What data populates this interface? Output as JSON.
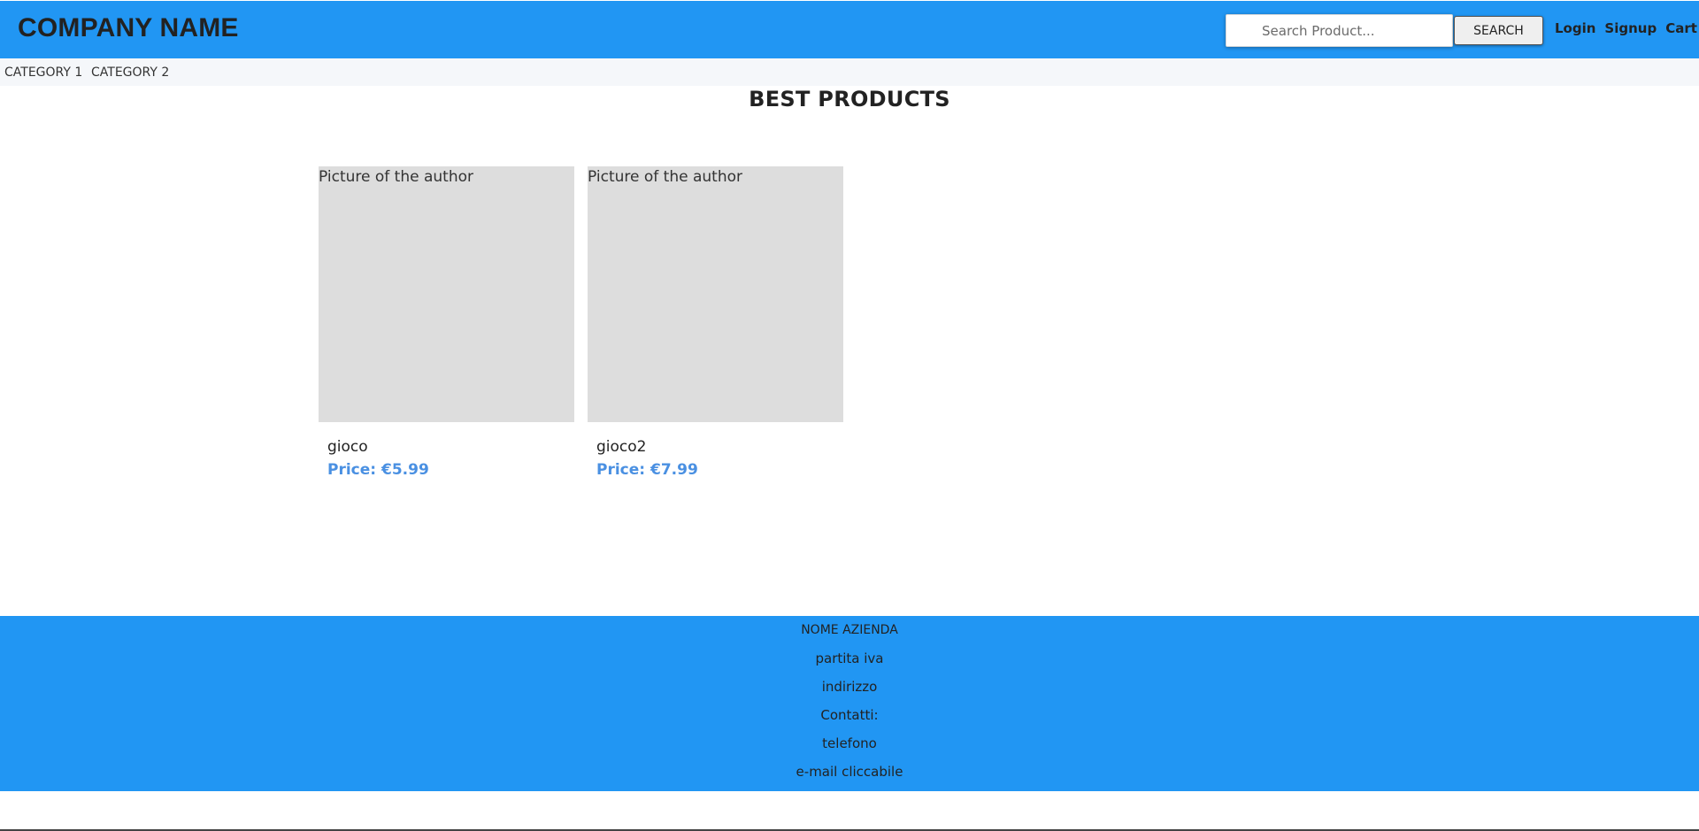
{
  "header": {
    "brand": "COMPANY NAME",
    "search_placeholder": "Search Product...",
    "search_button": "SEARCH",
    "links": {
      "login": "Login",
      "signup": "Signup",
      "cart": "Cart"
    },
    "bg_color": "#2196f3"
  },
  "categories": {
    "items": [
      "CATEGORY 1",
      "CATEGORY 2"
    ]
  },
  "main": {
    "title": "BEST PRODUCTS",
    "products": [
      {
        "image_alt": "Picture of the author",
        "name": "gioco",
        "price": "Price: €5.99"
      },
      {
        "image_alt": "Picture of the author",
        "name": "gioco2",
        "price": "Price: €7.99"
      }
    ],
    "price_color": "#4a90e2"
  },
  "footer": {
    "company": "NOME AZIENDA",
    "vat": "partita iva",
    "address": "indirizzo",
    "contacts_label": "Contatti:",
    "phone": "telefono",
    "email": "e-mail cliccabile"
  }
}
